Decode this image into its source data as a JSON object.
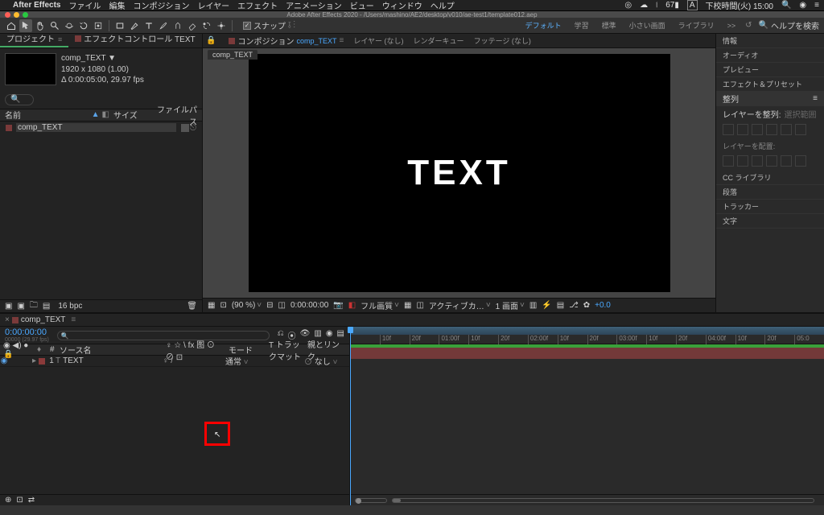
{
  "menubar": {
    "app": "After Effects",
    "items": [
      "ファイル",
      "編集",
      "コンポジション",
      "レイヤー",
      "エフェクト",
      "アニメーション",
      "ビュー",
      "ウィンドウ",
      "ヘルプ"
    ],
    "status": {
      "battery": "67",
      "lang": "A",
      "time": "下校時間(火) 15:00"
    }
  },
  "doc": {
    "title": "Adobe After Effects 2020 - /Users/mashino/AE2/desktop/v010/ae-test1/template012.aep"
  },
  "toolbar": {
    "snap_label": "スナップ",
    "workspaces": [
      "デフォルト",
      "学習",
      "標準",
      "小さい画面",
      "ライブラリ"
    ],
    "active_ws": 0,
    "more": ">>",
    "search_label": "ヘルプを検索"
  },
  "project": {
    "tab_project": "プロジェクト",
    "tab_effects": "エフェクトコントロール TEXT",
    "selected_name": "comp_TEXT ▼",
    "selected_dims": "1920 x 1080 (1.00)",
    "selected_dur": "Δ 0:00:05:00, 29.97 fps",
    "col_name": "名前",
    "col_type": "サイズ",
    "col_path": "ファイルパス",
    "row_name": "comp_TEXT",
    "bpc": "16 bpc"
  },
  "viewer": {
    "tab_prefix": "コンポジション",
    "comp_name": "comp_TEXT",
    "tab_layer": "レイヤー (なし)",
    "tab_flow": "レンダーキュー",
    "tab_footage": "フッテージ (なし)",
    "big_text": "TEXT",
    "zoom_pct": "(90 %)",
    "timecode": "0:00:00:00",
    "res": "フル画質",
    "view": "アクティブカ…",
    "views": "1 画面",
    "exposure": "+0.0"
  },
  "sidebar": {
    "items": [
      "情報",
      "オーディオ",
      "プレビュー",
      "エフェクト＆プリセット"
    ],
    "align_head": "整列",
    "align_label": "レイヤーを整列:",
    "align_target": "選択範囲",
    "dist_label": "レイヤーを配置:",
    "items2": [
      "CC ライブラリ",
      "段落",
      "トラッカー",
      "文字"
    ]
  },
  "timeline": {
    "tab": "comp_TEXT",
    "timecode": "0:00:00:00",
    "subcode": "00000 (29.97 fps)",
    "col_source": "ソース名",
    "switches_hdr": "♀ ☆ \\ fx 图 ⊙ ⊘ ⊡",
    "col_mode": "モード",
    "col_trk": "T トラックマット",
    "col_parent": "親とリンク",
    "row": {
      "num": "1",
      "type": "T",
      "name": "TEXT",
      "switches": "♀   /",
      "mode": "通常",
      "parent": "なし"
    },
    "ruler": [
      "10f",
      "20f",
      "01:00f",
      "10f",
      "20f",
      "02:00f",
      "10f",
      "20f",
      "03:00f",
      "10f",
      "20f",
      "04:00f",
      "10f",
      "20f",
      "05:0"
    ]
  }
}
